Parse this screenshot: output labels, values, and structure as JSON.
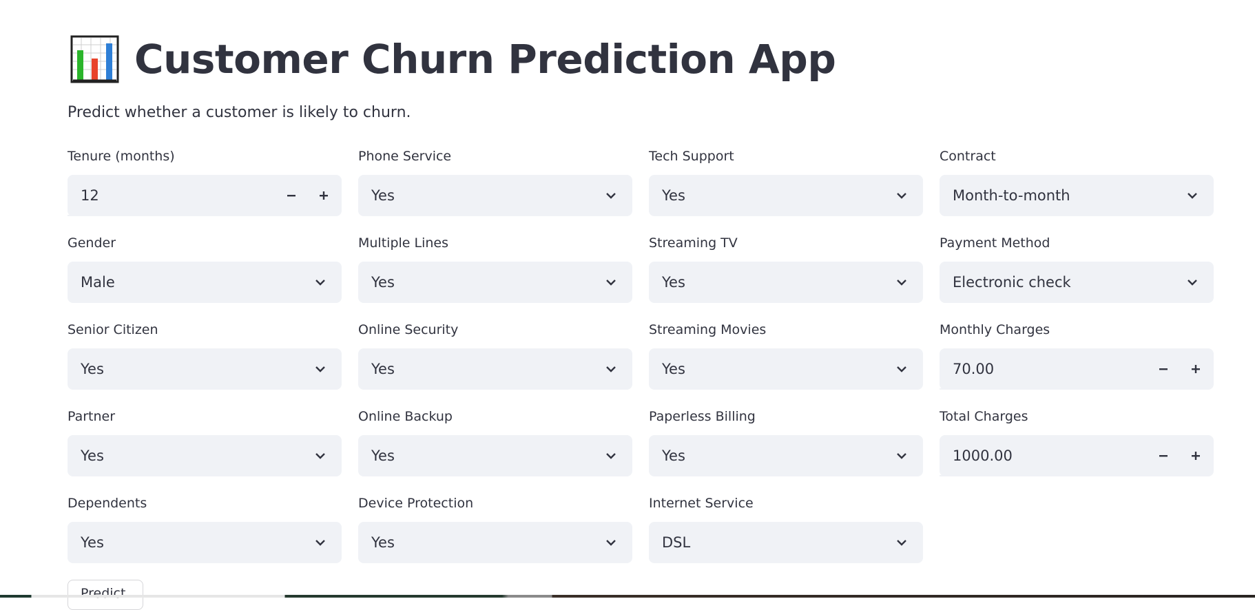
{
  "header": {
    "title": "Customer Churn Prediction App",
    "subtitle": "Predict whether a customer is likely to churn.",
    "emoji_icon": "bar-chart-icon"
  },
  "form": {
    "col1": [
      {
        "label": "Tenure (months)",
        "type": "number",
        "value": "12"
      },
      {
        "label": "Gender",
        "type": "select",
        "value": "Male"
      },
      {
        "label": "Senior Citizen",
        "type": "select",
        "value": "Yes"
      },
      {
        "label": "Partner",
        "type": "select",
        "value": "Yes"
      },
      {
        "label": "Dependents",
        "type": "select",
        "value": "Yes"
      }
    ],
    "col2": [
      {
        "label": "Phone Service",
        "type": "select",
        "value": "Yes"
      },
      {
        "label": "Multiple Lines",
        "type": "select",
        "value": "Yes"
      },
      {
        "label": "Online Security",
        "type": "select",
        "value": "Yes"
      },
      {
        "label": "Online Backup",
        "type": "select",
        "value": "Yes"
      },
      {
        "label": "Device Protection",
        "type": "select",
        "value": "Yes"
      }
    ],
    "col3": [
      {
        "label": "Tech Support",
        "type": "select",
        "value": "Yes"
      },
      {
        "label": "Streaming TV",
        "type": "select",
        "value": "Yes"
      },
      {
        "label": "Streaming Movies",
        "type": "select",
        "value": "Yes"
      },
      {
        "label": "Paperless Billing",
        "type": "select",
        "value": "Yes"
      },
      {
        "label": "Internet Service",
        "type": "select",
        "value": "DSL"
      }
    ],
    "col4": [
      {
        "label": "Contract",
        "type": "select",
        "value": "Month-to-month"
      },
      {
        "label": "Payment Method",
        "type": "select",
        "value": "Electronic check"
      },
      {
        "label": "Monthly Charges",
        "type": "number",
        "value": "70.00"
      },
      {
        "label": "Total Charges",
        "type": "number",
        "value": "1000.00"
      }
    ]
  },
  "actions": {
    "predict_label": "Predict"
  },
  "colors": {
    "text": "#31333f",
    "input_bg": "#f0f2f6",
    "background": "#ffffff"
  }
}
